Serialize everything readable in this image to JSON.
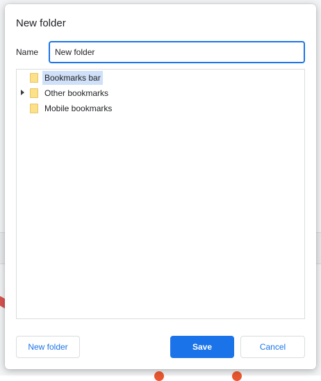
{
  "dialog": {
    "title": "New folder",
    "name_label": "Name",
    "name_value": "New folder"
  },
  "tree": {
    "items": [
      {
        "label": "Bookmarks bar",
        "selected": true,
        "expandable": false,
        "icon": "folder-icon"
      },
      {
        "label": "Other bookmarks",
        "selected": false,
        "expandable": true,
        "icon": "folder-icon"
      },
      {
        "label": "Mobile bookmarks",
        "selected": false,
        "expandable": false,
        "icon": "folder-icon"
      }
    ]
  },
  "buttons": {
    "new_folder": "New folder",
    "save": "Save",
    "cancel": "Cancel"
  },
  "colors": {
    "accent": "#1a73e8",
    "selection": "#cfe0f8",
    "folder": "#fce08a"
  }
}
